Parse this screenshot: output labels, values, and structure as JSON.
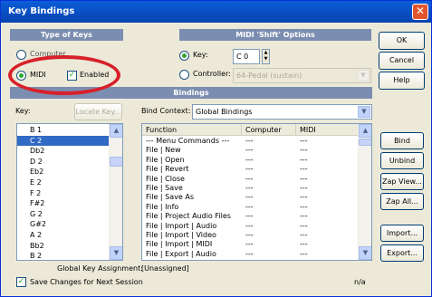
{
  "window": {
    "title": "Key Bindings",
    "close_glyph": "✕"
  },
  "type_of_keys": {
    "header": "Type of Keys",
    "computer_label": "Computer",
    "midi_label": "MIDI",
    "enabled_label": "Enabled",
    "selected": "MIDI",
    "enabled": true
  },
  "shift_options": {
    "header": "MIDI 'Shift' Options",
    "key_label": "Key:",
    "key_value": "C 0",
    "controller_label": "Controller:",
    "controller_value": "64-Pedal (sustain)",
    "selected": "Key"
  },
  "bindings_header": "Bindings",
  "key_label": "Key:",
  "locate_key_label": "Locate Key...",
  "bind_context_label": "Bind Context:",
  "bind_context_value": "Global Bindings",
  "keys": [
    "B 1",
    "C 2",
    "Db2",
    "D 2",
    "Eb2",
    "E 2",
    "F 2",
    "F#2",
    "G 2",
    "G#2",
    "A 2",
    "Bb2",
    "B 2"
  ],
  "selected_key": "C 2",
  "table": {
    "headers": [
      "Function",
      "Computer",
      "MIDI"
    ],
    "rows": [
      [
        "--- Menu Commands ---",
        "---",
        "---"
      ],
      [
        "File | New",
        "---",
        "---"
      ],
      [
        "File | Open",
        "---",
        "---"
      ],
      [
        "File | Revert",
        "---",
        "---"
      ],
      [
        "File | Close",
        "---",
        "---"
      ],
      [
        "File | Save",
        "---",
        "---"
      ],
      [
        "File | Save As",
        "---",
        "---"
      ],
      [
        "File | Info",
        "---",
        "---"
      ],
      [
        "File | Project Audio Files",
        "---",
        "---"
      ],
      [
        "File | Import | Audio",
        "---",
        "---"
      ],
      [
        "File | Import | Video",
        "---",
        "---"
      ],
      [
        "File | Import | MIDI",
        "---",
        "---"
      ],
      [
        "File | Export | Audio",
        "---",
        "---"
      ]
    ]
  },
  "global_assignment_label": "Global Key Assignment:",
  "global_assignment_value": "[Unassigned]",
  "save_changes_label": "Save Changes for Next Session",
  "save_changes_checked": true,
  "status_value": "n/a",
  "buttons": {
    "ok": "OK",
    "cancel": "Cancel",
    "help": "Help",
    "bind": "Bind",
    "unbind": "Unbind",
    "zap_view": "Zap View...",
    "zap_all": "Zap All...",
    "import": "Import...",
    "export": "Export..."
  },
  "colors": {
    "highlight": "#316ac5",
    "annotation": "#d8202a",
    "titlebar": "#0a52c8"
  }
}
